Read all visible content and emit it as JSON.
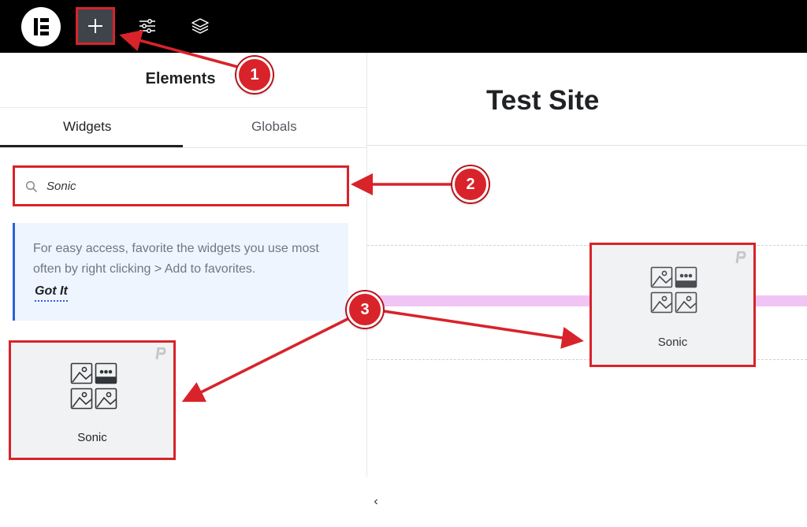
{
  "toolbar": {
    "logo_icon": "elementor-logo-icon",
    "add_icon": "plus-icon",
    "settings_icon": "sliders-icon",
    "layers_icon": "layers-icon"
  },
  "panel": {
    "title": "Elements",
    "tabs": [
      {
        "label": "Widgets",
        "active": true
      },
      {
        "label": "Globals",
        "active": false
      }
    ],
    "search": {
      "value": "Sonic",
      "icon": "search-icon"
    },
    "notice": {
      "text": "For easy access, favorite the widgets you use most often by right clicking > Add to favorites.",
      "link": "Got It"
    },
    "widget": {
      "label": "Sonic",
      "icon": "gallery-grid-icon",
      "badge_icon": "pro-icon"
    },
    "collapse_icon": "chevron-left-icon",
    "collapse_glyph": "‹"
  },
  "canvas": {
    "site_title": "Test Site",
    "dragged_widget": {
      "label": "Sonic",
      "icon": "gallery-grid-icon",
      "badge_icon": "pro-icon"
    },
    "drop_indicator_color": "#f0c5f5"
  },
  "annotations": {
    "step_1": "1",
    "step_2": "2",
    "step_3": "3",
    "color": "#d8232a"
  }
}
